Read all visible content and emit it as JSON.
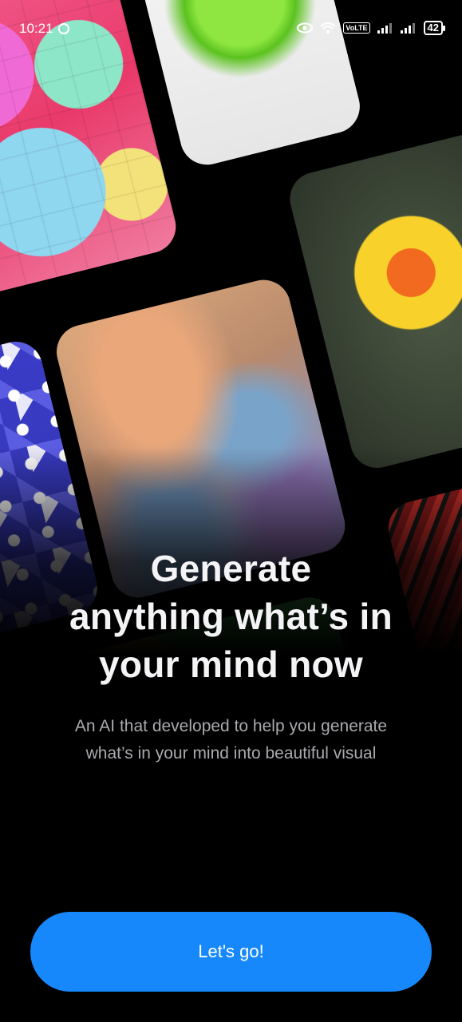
{
  "status_bar": {
    "time": "10:21",
    "network_badge": "VoLTE",
    "battery_level": "42",
    "icons": [
      "clock-alarm-icon",
      "eye-icon",
      "wifi-icon",
      "volte-icon",
      "signal-icon",
      "signal-icon",
      "battery-icon"
    ]
  },
  "collage": {
    "tiles": [
      "pastel-cubes",
      "plant",
      "green-coral",
      "geometric-pattern",
      "marble-swirl",
      "yellow-flower",
      "red-waves",
      "colorful-shapes"
    ]
  },
  "onboarding": {
    "headline_line1": "Generate",
    "headline_line2": "anything what’s in",
    "headline_line3": "your mind now",
    "subtitle_line1": "An AI that developed to help you generate",
    "subtitle_line2": "what’s in your mind into beautiful visual",
    "cta_label": "Let's go!"
  },
  "colors": {
    "background": "#000000",
    "accent": "#1688fc",
    "headline": "#f4f4f6",
    "subtitle": "#a9a9ae"
  }
}
